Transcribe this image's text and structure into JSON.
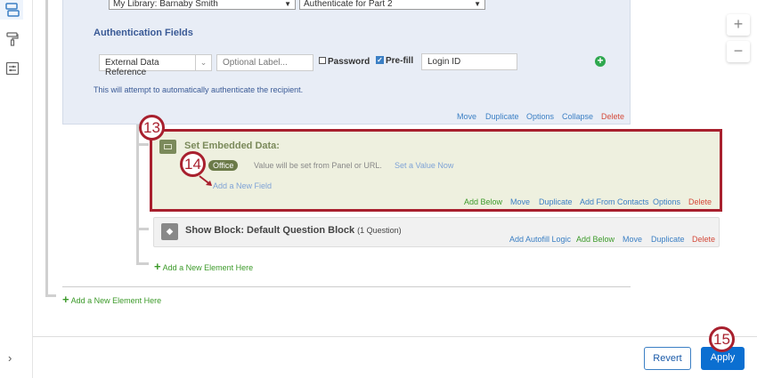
{
  "auth_block": {
    "library_select": "My Library: Barnaby Smith",
    "auth_select": "Authenticate for Part 2",
    "heading": "Authentication Fields",
    "field_type": "External Data Reference",
    "label_placeholder": "Optional Label...",
    "password_label": "Password",
    "password_checked": false,
    "prefill_label": "Pre-fill",
    "prefill_checked": true,
    "login_value": "Login ID",
    "note": "This will attempt to automatically authenticate the recipient.",
    "actions": {
      "move": "Move",
      "duplicate": "Duplicate",
      "options": "Options",
      "collapse": "Collapse",
      "delete": "Delete"
    }
  },
  "embedded": {
    "title": "Set Embedded Data:",
    "field_name": "Office",
    "field_value_text": "Value will be set from Panel or URL.",
    "set_value": "Set a Value Now",
    "add_field": "Add a New Field",
    "actions": {
      "add_below": "Add Below",
      "move": "Move",
      "duplicate": "Duplicate",
      "add_from_contacts": "Add From Contacts",
      "options": "Options",
      "delete": "Delete"
    }
  },
  "show_block": {
    "title": "Show Block: Default Question Block",
    "count": "(1 Question)",
    "actions": {
      "autofill": "Add Autofill Logic",
      "add_below": "Add Below",
      "move": "Move",
      "duplicate": "Duplicate",
      "delete": "Delete"
    }
  },
  "add_element_inner": "Add a New Element Here",
  "add_element_outer": "Add a New Element Here",
  "annotations": {
    "a13": "13",
    "a14": "14",
    "a15": "15"
  },
  "footer": {
    "revert": "Revert",
    "apply": "Apply"
  },
  "zoom": {
    "in": "+",
    "out": "−"
  }
}
